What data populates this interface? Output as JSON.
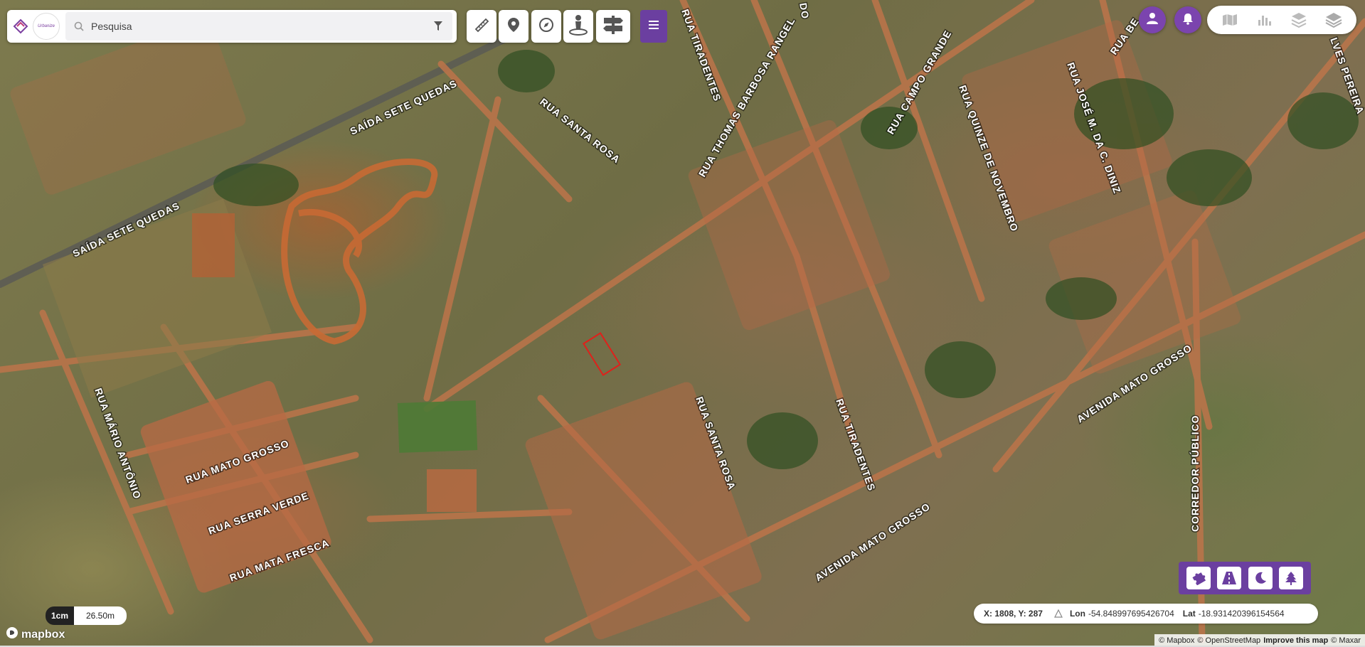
{
  "search": {
    "placeholder": "Pesquisa",
    "logo_text": "Urbanize"
  },
  "toolbar": {
    "tools": [
      "measure-icon",
      "marker-icon",
      "compass-icon",
      "street-view-icon",
      "signpost-icon"
    ],
    "menu_icon": "hamburger-icon"
  },
  "topright": {
    "user_icon": "user-icon",
    "notifications_icon": "bell-icon",
    "layers": [
      "map-icon",
      "chart-icon",
      "layers-grid-icon",
      "stack-icon"
    ]
  },
  "streets": [
    "SAÍDA SETE QUEDAS",
    "SAÍDA SETE QUEDAS",
    "RUA SANTA ROSA",
    "RUA TIRADENTES",
    "RUA THOMAS BARBOSA RANGEL",
    "RUA CAMPO GRANDE",
    "RUA QUINZE DE NOVEMBRO",
    "RUA JOSÉ M. DA C. DINIZ",
    "RUA MÁRIO ANTÔNIO",
    "RUA MATO GROSSO",
    "RUA SERRA VERDE",
    "RUA MATA FRESCA",
    "RUA SANTA ROSA",
    "RUA TIRADENTES",
    "AVENIDA MATO GROSSO",
    "AVENIDA MATO GROSSO",
    "CORREDOR PÚBLICO",
    "RUA BE",
    "LVES PEREIRA",
    "RUA TIRADENTES",
    "DO"
  ],
  "map_style_tools": [
    "puzzle-icon",
    "road-icon",
    "moon-icon",
    "tree-icon"
  ],
  "coords": {
    "xy": "X: 1808, Y: 287",
    "lon_label": "Lon",
    "lon_value": "-54.848997695426704",
    "lat_label": "Lat",
    "lat_value": "-18.931420396154564"
  },
  "scale": {
    "unit": "1cm",
    "distance": "26.50m"
  },
  "brand": "mapbox",
  "attribution": {
    "mapbox": "© Mapbox",
    "osm": "© OpenStreetMap",
    "improve": "Improve this map",
    "maxar": "© Maxar"
  },
  "colors": {
    "accent": "#6b3fa0",
    "selection": "#e0201b"
  }
}
